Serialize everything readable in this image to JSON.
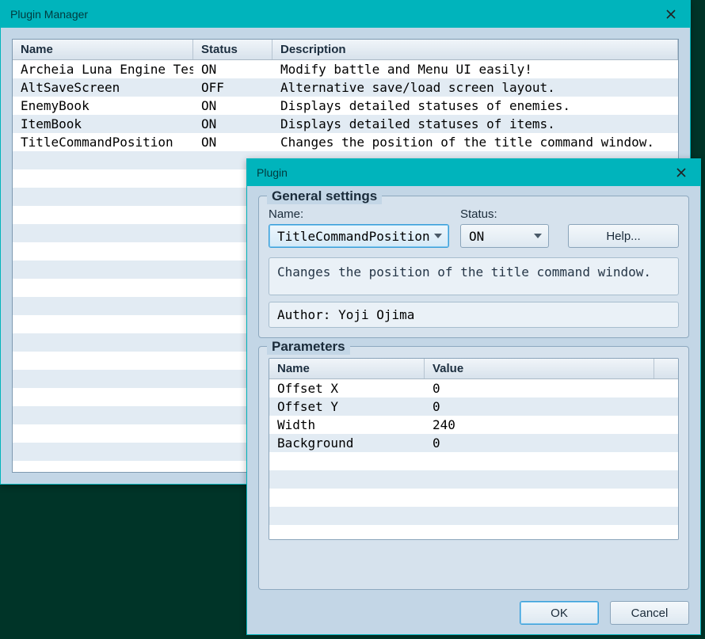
{
  "manager": {
    "title": "Plugin Manager",
    "columns": {
      "name": "Name",
      "status": "Status",
      "description": "Description"
    },
    "rows": [
      {
        "name": "Archeia Luna Engine Test",
        "status": "ON",
        "description": "Modify battle and Menu UI easily!"
      },
      {
        "name": "AltSaveScreen",
        "status": "OFF",
        "description": "Alternative save/load screen layout."
      },
      {
        "name": "EnemyBook",
        "status": "ON",
        "description": "Displays detailed statuses of enemies."
      },
      {
        "name": "ItemBook",
        "status": "ON",
        "description": "Displays detailed statuses of items."
      },
      {
        "name": "TitleCommandPosition",
        "status": "ON",
        "description": "Changes the position of the title command window."
      }
    ],
    "blank_rows": 17
  },
  "dialog": {
    "title": "Plugin",
    "general": {
      "heading": "General settings",
      "name_label": "Name:",
      "status_label": "Status:",
      "name_value": "TitleCommandPosition",
      "status_value": "ON",
      "help_label": "Help...",
      "description": "Changes the position of the title command window.",
      "author": "Author: Yoji Ojima"
    },
    "params": {
      "heading": "Parameters",
      "columns": {
        "name": "Name",
        "value": "Value"
      },
      "rows": [
        {
          "name": "Offset X",
          "value": "0"
        },
        {
          "name": "Offset Y",
          "value": "0"
        },
        {
          "name": "Width",
          "value": "240"
        },
        {
          "name": "Background",
          "value": "0"
        }
      ],
      "blank_rows": 5
    },
    "buttons": {
      "ok": "OK",
      "cancel": "Cancel"
    }
  }
}
